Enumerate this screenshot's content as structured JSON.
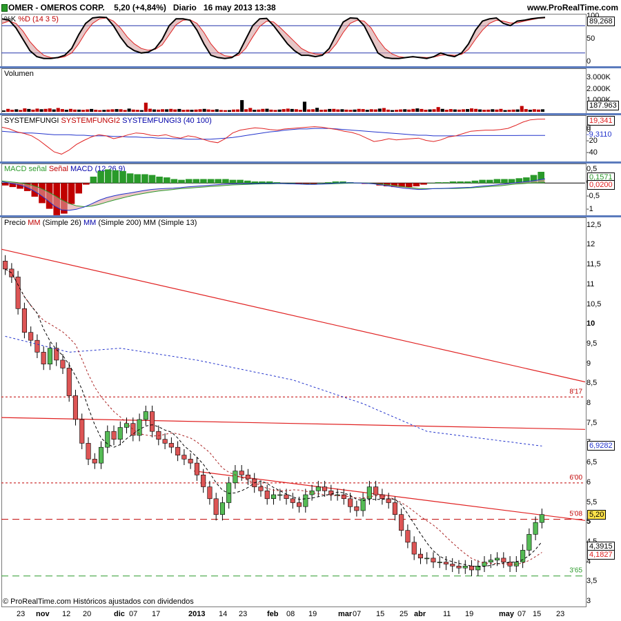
{
  "header": {
    "title": "OMER - OMEROS CORP.",
    "quote": "5,20 (+4,84%)",
    "period": "Diario",
    "date": "16 may 2013 13:38",
    "source": "www.ProRealTime.com"
  },
  "footer": "© ProRealTime.com Históricos ajustados con dividendos",
  "colors": {
    "up": "#2a9a2a",
    "down": "#c00000",
    "blue": "#2233cc",
    "red": "#e02020",
    "black": "#000000"
  },
  "chart_data": [
    {
      "type": "line",
      "name": "stochastic",
      "legend": [
        "%K",
        "%D (14 3 5)"
      ],
      "ylim": [
        0,
        100
      ],
      "ticks": [
        "100",
        "50",
        "0"
      ],
      "levels": [
        80,
        20
      ],
      "last_value": "89,268",
      "series": [
        {
          "name": "%K",
          "values": [
            95,
            92,
            75,
            50,
            25,
            12,
            8,
            8,
            10,
            15,
            30,
            60,
            85,
            97,
            99,
            98,
            80,
            55,
            35,
            25,
            20,
            22,
            30,
            50,
            80,
            95,
            95,
            92,
            70,
            40,
            15,
            10,
            8,
            10,
            20,
            50,
            80,
            95,
            96,
            80,
            60,
            40,
            25,
            15,
            15,
            12,
            15,
            30,
            60,
            88,
            97,
            96,
            80,
            50,
            20,
            10,
            8,
            8,
            10,
            12,
            10,
            8,
            12,
            20,
            15,
            12,
            20,
            40,
            70,
            90,
            95,
            97,
            85,
            80,
            90,
            92,
            95,
            97,
            98
          ]
        },
        {
          "name": "%D",
          "values": [
            85,
            90,
            85,
            68,
            45,
            28,
            15,
            10,
            9,
            12,
            20,
            40,
            65,
            85,
            95,
            97,
            90,
            75,
            55,
            40,
            30,
            26,
            28,
            38,
            60,
            82,
            92,
            93,
            85,
            65,
            40,
            22,
            14,
            12,
            15,
            30,
            55,
            78,
            90,
            88,
            75,
            60,
            45,
            30,
            22,
            18,
            17,
            22,
            40,
            65,
            85,
            92,
            90,
            75,
            50,
            30,
            18,
            12,
            10,
            11,
            11,
            10,
            11,
            15,
            16,
            15,
            17,
            28,
            50,
            70,
            85,
            92,
            90,
            86,
            86,
            90,
            93,
            96,
            97
          ]
        }
      ]
    },
    {
      "type": "bar",
      "name": "volume",
      "legend": "Volumen",
      "ticks": [
        "3.000K",
        "2.000K",
        "1.000K"
      ],
      "ylim": [
        0,
        3200
      ],
      "last_value": "187.963",
      "values": [
        120,
        260,
        180,
        220,
        160,
        300,
        250,
        190,
        280,
        230,
        260,
        300,
        210,
        340,
        240,
        180,
        260,
        200,
        190,
        170,
        210,
        250,
        180,
        150,
        170,
        200,
        220,
        240,
        230,
        160,
        280,
        200,
        170,
        150,
        810,
        270,
        210,
        190,
        230,
        220,
        260,
        210,
        250,
        170,
        190,
        180,
        200,
        230,
        260,
        210,
        180,
        220,
        160,
        140,
        150,
        200,
        210,
        1040,
        230,
        340,
        180,
        200,
        260,
        270,
        190,
        160,
        200,
        240,
        280,
        250,
        230,
        170,
        900,
        210,
        230,
        350,
        180,
        200,
        250,
        260,
        210,
        230,
        190,
        170,
        200,
        260,
        240,
        170,
        230,
        210,
        280,
        330,
        190,
        150,
        170,
        210,
        230,
        200,
        260,
        300,
        250,
        180,
        210,
        230,
        420,
        260,
        180,
        240,
        210,
        190,
        220,
        240,
        300,
        260,
        210,
        180,
        190,
        230,
        200,
        260,
        150,
        170,
        200,
        210,
        520,
        240,
        180,
        230,
        200,
        220
      ],
      "colors_up_mask": "alternating"
    },
    {
      "type": "line",
      "name": "systemfungi",
      "legend": [
        "SYSTEMFUNGI",
        "SYSTEMFUNGI2",
        "SYSTEMFUNGI3 (40 100)"
      ],
      "ticks": [
        "0",
        "-20",
        "-40"
      ],
      "ylim": [
        -50,
        20
      ],
      "last_values": [
        "19,341",
        "0",
        "-9,3110"
      ],
      "series": [
        {
          "name": "SYSTEMFUNGI",
          "values": [
            5,
            2,
            -3,
            -6,
            -10,
            -18,
            -28,
            -38,
            -42,
            -35,
            -25,
            -18,
            -12,
            -8,
            -10,
            -15,
            -12,
            -8,
            -5,
            -6,
            -9,
            -10,
            -8,
            -12,
            -14,
            -10,
            -12,
            -16,
            -20,
            -22,
            -15,
            -5,
            0,
            2,
            4,
            3,
            1,
            0,
            2,
            3,
            4,
            5,
            6,
            5,
            3,
            1,
            -2,
            -4,
            -8,
            -14,
            -20,
            -18,
            -15,
            -17,
            -16,
            -15,
            -14,
            -18,
            -20,
            -17,
            -12,
            -10,
            -6,
            -2,
            -1,
            0,
            0,
            1,
            3,
            8,
            14,
            18,
            19,
            19.3
          ]
        },
        {
          "name": "SYSTEMFUNGI3",
          "values": [
            -2,
            -3,
            -4,
            -5,
            -5,
            -6,
            -7,
            -8,
            -8,
            -8,
            -9,
            -9,
            -10,
            -10,
            -10,
            -11,
            -11,
            -12,
            -12,
            -13,
            -13,
            -14,
            -14,
            -15,
            -15,
            -16,
            -16,
            -16,
            -16,
            -15,
            -14,
            -13,
            -11,
            -9,
            -7,
            -5,
            -3,
            -2,
            0,
            1,
            2,
            2,
            3,
            3,
            3,
            2,
            1,
            0,
            -1,
            -2,
            -3,
            -4,
            -5,
            -6,
            -7,
            -8,
            -9,
            -9,
            -10,
            -10,
            -10,
            -10,
            -10,
            -9.5,
            -9.5,
            -9.5,
            -9.5,
            -9.4,
            -9.4,
            -9.4,
            -9.3,
            -9.3,
            -9.3,
            -9.3
          ]
        }
      ]
    },
    {
      "type": "line",
      "name": "macd",
      "legend": [
        "MACD",
        "señal",
        "Señal",
        "MACD (12 26 9)"
      ],
      "ticks": [
        "0,5",
        "0",
        "-0,5",
        "-1"
      ],
      "ylim": [
        -1.1,
        0.6
      ],
      "last_values": [
        "0,1571",
        "0,0200"
      ],
      "macd": [
        0.05,
        0,
        -0.05,
        -0.12,
        -0.25,
        -0.42,
        -0.62,
        -0.85,
        -1.0,
        -1.02,
        -0.98,
        -0.9,
        -0.78,
        -0.65,
        -0.55,
        -0.48,
        -0.42,
        -0.38,
        -0.33,
        -0.28,
        -0.24,
        -0.22,
        -0.2,
        -0.19,
        -0.17,
        -0.14,
        -0.12,
        -0.1,
        -0.08,
        -0.06,
        -0.04,
        -0.03,
        -0.02,
        -0.02,
        -0.02,
        -0.01,
        -0.01,
        -0.01,
        -0.02,
        -0.03,
        -0.04,
        -0.05,
        -0.05,
        -0.04,
        -0.02,
        0,
        0.01,
        0.01,
        0,
        -0.01,
        -0.03,
        -0.07,
        -0.11,
        -0.15,
        -0.19,
        -0.22,
        -0.24,
        -0.23,
        -0.21,
        -0.2,
        -0.19,
        -0.18,
        -0.17,
        -0.16,
        -0.13,
        -0.1,
        -0.08,
        -0.05,
        -0.02,
        0.01,
        0.04,
        0.07,
        0.11,
        0.16
      ],
      "signal": [
        0.08,
        0.05,
        0.02,
        -0.02,
        -0.08,
        -0.17,
        -0.3,
        -0.45,
        -0.62,
        -0.76,
        -0.85,
        -0.88,
        -0.86,
        -0.8,
        -0.72,
        -0.64,
        -0.57,
        -0.5,
        -0.44,
        -0.39,
        -0.34,
        -0.3,
        -0.27,
        -0.24,
        -0.21,
        -0.19,
        -0.17,
        -0.15,
        -0.13,
        -0.11,
        -0.09,
        -0.07,
        -0.06,
        -0.05,
        -0.04,
        -0.03,
        -0.03,
        -0.02,
        -0.02,
        -0.03,
        -0.03,
        -0.04,
        -0.04,
        -0.04,
        -0.03,
        -0.02,
        -0.01,
        0,
        0,
        0,
        -0.02,
        -0.04,
        -0.07,
        -0.1,
        -0.14,
        -0.17,
        -0.2,
        -0.21,
        -0.21,
        -0.21,
        -0.2,
        -0.2,
        -0.19,
        -0.18,
        -0.16,
        -0.14,
        -0.12,
        -0.1,
        -0.07,
        -0.04,
        -0.02,
        0,
        0.01,
        0.02
      ]
    },
    {
      "type": "candlestick",
      "name": "price",
      "legend": [
        "Precio",
        "MM",
        "(Simple 26)",
        "MM",
        "(Simple 200)",
        "MM",
        "(Simple 13)"
      ],
      "ylim": [
        3,
        12.6
      ],
      "ticks": [
        "12,5",
        "12",
        "11,5",
        "11",
        "10,5",
        "10",
        "9,5",
        "9",
        "8,5",
        "8",
        "7,5",
        "7",
        "6,5",
        "6",
        "5,5",
        "5",
        "4,5",
        "4",
        "3,5",
        "3"
      ],
      "last_price": "5,20",
      "ma200_last": "6,9282",
      "ma26_last": "4,3915",
      "ma13_last": "4,1827",
      "levels": [
        {
          "value": 8.17,
          "label": "8'17",
          "color": "#c00000",
          "style": "dotted"
        },
        {
          "value": 6.0,
          "label": "6'00",
          "color": "#c00000",
          "style": "dotted"
        },
        {
          "value": 5.08,
          "label": "5'08",
          "color": "#c00000",
          "style": "dashed"
        },
        {
          "value": 3.65,
          "label": "3'65",
          "color": "#2a9a2a",
          "style": "dashed"
        }
      ],
      "trendlines": [
        {
          "from": [
            0,
            11.9
          ],
          "to": [
            1,
            8.55
          ]
        },
        {
          "from": [
            0,
            7.65
          ],
          "to": [
            1,
            7.35
          ]
        },
        {
          "from": [
            0.33,
            6.3
          ],
          "to": [
            1,
            5.05
          ]
        }
      ],
      "closes": [
        11.4,
        11.2,
        10.4,
        9.8,
        9.6,
        9.3,
        9.0,
        9.4,
        9.1,
        8.9,
        8.2,
        7.6,
        7.0,
        6.6,
        6.5,
        6.9,
        7.3,
        7.1,
        7.4,
        7.5,
        7.2,
        7.6,
        7.8,
        7.3,
        7.1,
        7.0,
        6.9,
        6.7,
        6.6,
        6.5,
        6.2,
        5.9,
        5.6,
        5.2,
        5.5,
        6.0,
        6.3,
        6.2,
        6.1,
        5.9,
        5.8,
        5.6,
        5.7,
        5.7,
        5.6,
        5.5,
        5.4,
        5.7,
        5.8,
        5.9,
        5.8,
        5.7,
        5.7,
        5.6,
        5.4,
        5.3,
        5.6,
        5.9,
        5.7,
        5.6,
        5.5,
        5.2,
        4.8,
        4.5,
        4.2,
        4.1,
        4.1,
        4.0,
        4.0,
        3.95,
        3.9,
        3.85,
        3.9,
        3.8,
        3.9,
        4.0,
        4.05,
        4.1,
        4.0,
        3.9,
        4.0,
        4.3,
        4.7,
        5.0,
        5.2
      ]
    }
  ],
  "x_axis": [
    "23",
    "nov",
    "12",
    "20",
    "dic",
    "07",
    "17",
    "2013",
    "14",
    "23",
    "feb",
    "08",
    "19",
    "mar",
    "07",
    "15",
    "25",
    "abr",
    "11",
    "19",
    "may",
    "07",
    "15",
    "23"
  ]
}
